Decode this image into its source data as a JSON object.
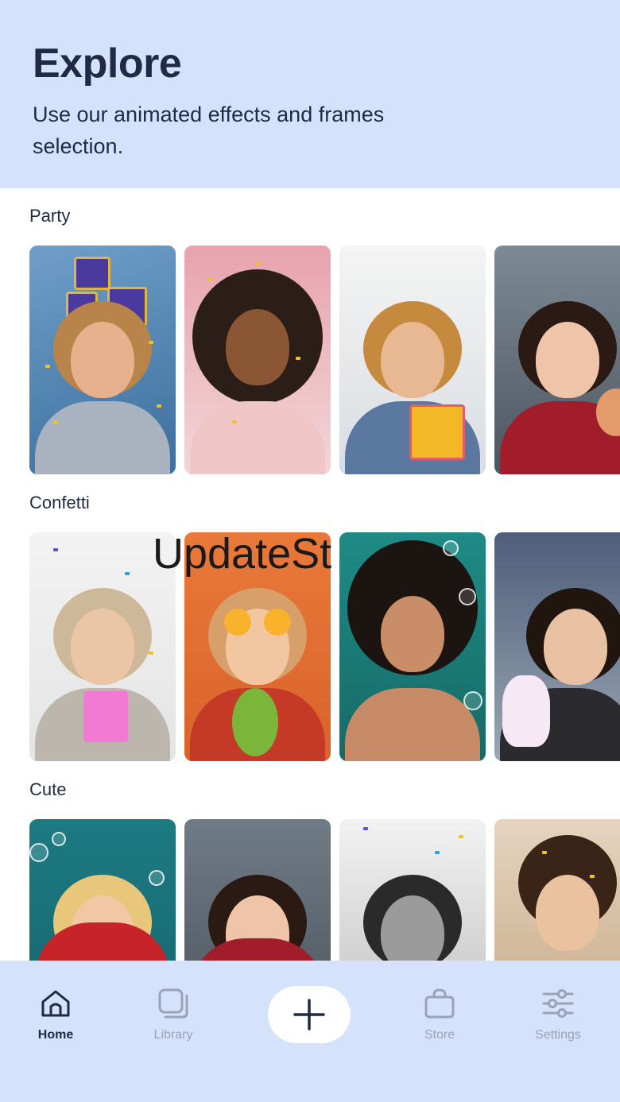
{
  "header": {
    "title": "Explore",
    "subtitle": "Use our animated effects and frames selection."
  },
  "sections": [
    {
      "title": "Party"
    },
    {
      "title": "Confetti"
    },
    {
      "title": "Cute"
    }
  ],
  "overlay": {
    "text": "UpdateSt"
  },
  "nav": {
    "items": [
      {
        "label": "Home",
        "icon": "home-icon",
        "active": true
      },
      {
        "label": "Library",
        "icon": "library-icon",
        "active": false
      },
      {
        "label": "",
        "icon": "plus-icon",
        "active": false
      },
      {
        "label": "Store",
        "icon": "shopping-bag-icon",
        "active": false
      },
      {
        "label": "Settings",
        "icon": "sliders-icon",
        "active": false
      }
    ]
  },
  "colors": {
    "header_bg": "#d5e2fb",
    "nav_bg": "#d5e2fb",
    "text_dark": "#1f2a44",
    "text_muted": "#9aa3b5"
  }
}
